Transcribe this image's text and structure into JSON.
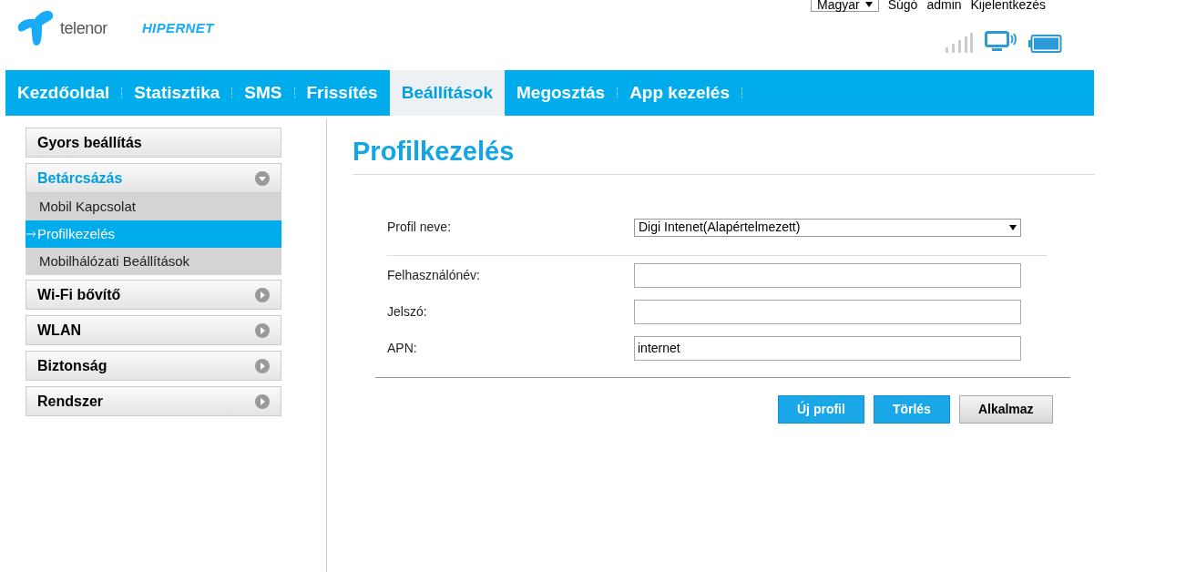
{
  "header": {
    "brand": "telenor",
    "product": "HIPERNET",
    "language": "Magyar",
    "links": [
      "Súgó",
      "admin",
      "Kijelentkezés"
    ]
  },
  "nav": [
    {
      "label": "Kezdőoldal",
      "selected": false
    },
    {
      "label": "Statisztika",
      "selected": false
    },
    {
      "label": "SMS",
      "selected": false
    },
    {
      "label": "Frissítés",
      "selected": false
    },
    {
      "label": "Beállítások",
      "selected": true
    },
    {
      "label": "Megosztás",
      "selected": false
    },
    {
      "label": "App kezelés",
      "selected": false
    }
  ],
  "sidebar": [
    {
      "label": "Gyors beállítás",
      "kind": "plain"
    },
    {
      "label": "Betárcsázás",
      "kind": "group",
      "expanded": true,
      "children": [
        {
          "label": "Mobil Kapcsolat",
          "selected": false
        },
        {
          "label": "Profilkezelés",
          "selected": true
        },
        {
          "label": "Mobilhálózati Beállítások",
          "selected": false
        }
      ]
    },
    {
      "label": "Wi-Fi bővítő",
      "kind": "group",
      "expanded": false
    },
    {
      "label": "WLAN",
      "kind": "group",
      "expanded": false
    },
    {
      "label": "Biztonság",
      "kind": "group",
      "expanded": false
    },
    {
      "label": "Rendszer",
      "kind": "group",
      "expanded": false
    }
  ],
  "title": "Profilkezelés",
  "form": [
    {
      "label": "Profil neve:",
      "kind": "select",
      "value": "Digi Intenet(Alapértelmezett)"
    },
    {
      "label": "Felhasználónév:",
      "kind": "text"
    },
    {
      "label": "Jelszó:",
      "kind": "text"
    },
    {
      "label": "APN:",
      "kind": "text",
      "value": "internet"
    }
  ],
  "buttons": [
    {
      "label": "Új profil",
      "kind": "primary"
    },
    {
      "label": "Törlés",
      "kind": "primary"
    },
    {
      "label": "Alkalmaz",
      "kind": "secondary"
    }
  ]
}
